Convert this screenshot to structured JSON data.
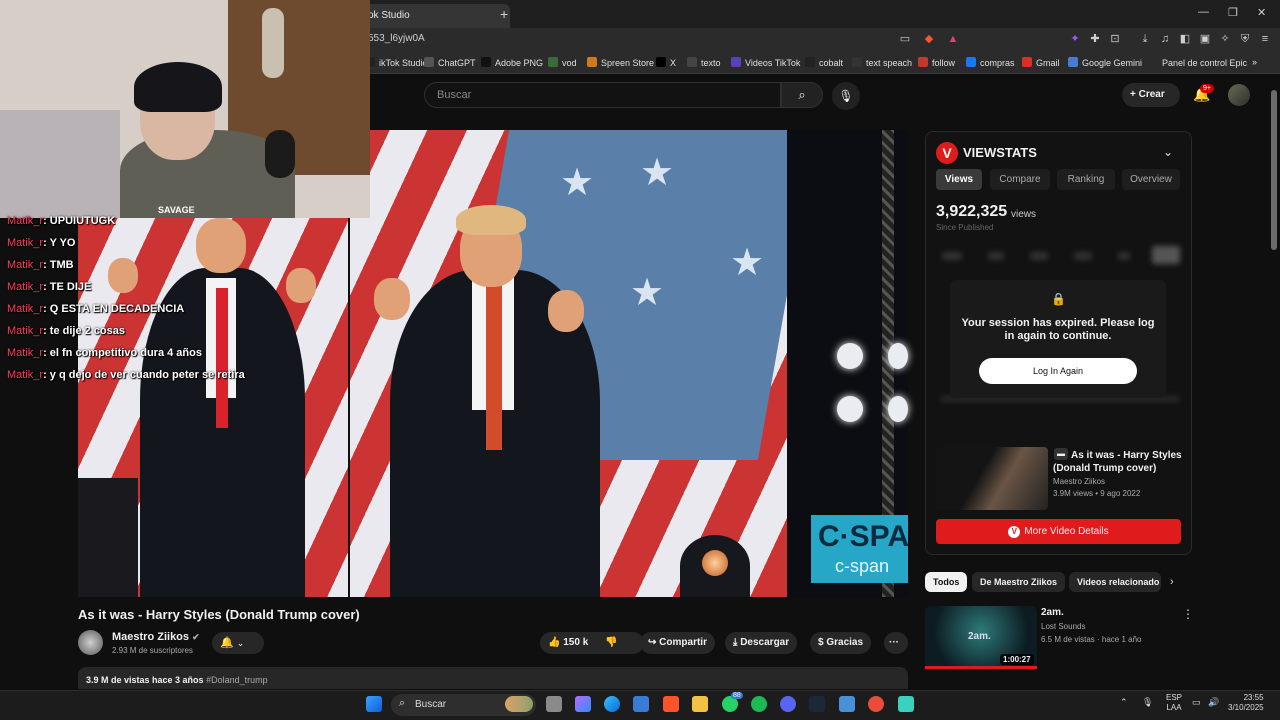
{
  "browser": {
    "tab_title": "ok Studio",
    "new_tab": "+",
    "url": "553_l6yjw0A",
    "window_controls": [
      "—",
      "❐",
      "✕"
    ],
    "bookmarks": [
      {
        "label": "ikTok Studio",
        "color": "#222222"
      },
      {
        "label": "ChatGPT",
        "color": "#555555"
      },
      {
        "label": "Adobe PNG",
        "color": "#111111"
      },
      {
        "label": "vod",
        "color": "#3a6b3a"
      },
      {
        "label": "Spreen Store",
        "color": "#d07a20"
      },
      {
        "label": "X",
        "color": "#000000"
      },
      {
        "label": "texto",
        "color": "#444444"
      },
      {
        "label": "Videos TikTok",
        "color": "#5b3fb8"
      },
      {
        "label": "cobalt",
        "color": "#222222"
      },
      {
        "label": "text speach",
        "color": "#333333"
      },
      {
        "label": "follow",
        "color": "#c0392b"
      },
      {
        "label": "compras",
        "color": "#1877f2"
      },
      {
        "label": "Gmail",
        "color": "#d93025"
      },
      {
        "label": "Google Gemini",
        "color": "#4a7bd4"
      },
      {
        "label": "Panel de control Epic",
        "color": "#2b2b2b"
      }
    ],
    "bookmarks_more": "»"
  },
  "youtube": {
    "search_placeholder": "Buscar",
    "create_label": "Crear",
    "create_icon": "+",
    "notification_badge": "9+",
    "video": {
      "title": "As it was - Harry Styles (Donald Trump cover)",
      "channel": "Maestro Ziikos",
      "verified": "✔",
      "subscribers": "2.93 M de suscriptores",
      "likes": "150 k",
      "share_label": "Compartir",
      "download_label": "Descargar",
      "thanks_label": "Gracias",
      "more": "···",
      "description_stats": "3.9 M de vistas  hace 3 años",
      "hashtag": "#Doland_trump",
      "watermark_top": "C·SPA",
      "watermark_bottom": "c-span"
    },
    "chips": [
      "Todos",
      "De Maestro Ziikos",
      "Videos relacionado"
    ],
    "chip_next": "›",
    "recommendation": {
      "title": "2am.",
      "thumb_text": "2am.",
      "channel": "Lost Sounds",
      "meta": "6.5 M de vistas · hace 1 año",
      "duration": "1:00:27",
      "watched": 1.0
    }
  },
  "viewstats": {
    "logo": "V",
    "title": "VIEWSTATS",
    "collapse_icon": "⌄",
    "tabs": [
      "Views",
      "Compare",
      "Ranking",
      "Overview"
    ],
    "active_tab": "Views",
    "views_count": "3,922,325",
    "views_unit": "views",
    "since": "Since Published",
    "session_message": "Your session has expired. Please log in again to continue.",
    "login_label": "Log In Again",
    "video_title": "As it was - Harry Styles (Donald Trump cover)",
    "video_channel": "Maestro Ziikos",
    "video_meta": "3.9M views • 9 ago 2022",
    "details_label": "More Video Details"
  },
  "chat": [
    {
      "user": "Matik_r",
      "message": ": UPUIUTUGK"
    },
    {
      "user": "Matik_r",
      "message": ": Y YO"
    },
    {
      "user": "Matik_r",
      "message": ": TMB"
    },
    {
      "user": "Matik_r",
      "message": ": TE DIJE"
    },
    {
      "user": "Matik_r",
      "message": ": Q ESTA EN DECADENCIA"
    },
    {
      "user": "Matik_r",
      "message": ": te dije 2 cosas"
    },
    {
      "user": "Matik_r",
      "message": ": el fn competitivo dura 4 años"
    },
    {
      "user": "Matik_r",
      "message": ": y q dejo de ver cuando peter se retira"
    }
  ],
  "webcam": {
    "shirt_text": "SAVAGE"
  },
  "taskbar": {
    "search_label": "Buscar",
    "whatsapp_badge": "88",
    "language_line1": "ESP",
    "language_line2": "LAA",
    "time": "23:55",
    "date": "3/10/2025"
  },
  "colors": {
    "youtube_red": "#e01b1b",
    "background": "#0f0f0f",
    "chat_user": "#ff3b5c"
  }
}
